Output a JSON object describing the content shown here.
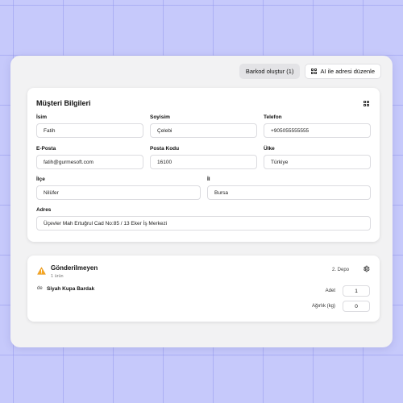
{
  "toolbar": {
    "barcode_label": "Barkod oluştur (1)",
    "ai_address_label": "AI ile adresi düzenle",
    "ai_icon": "grid-icon"
  },
  "customer": {
    "title": "Müşteri Bilgileri",
    "corner_icon": "grid-icon",
    "fields": {
      "first_name": {
        "label": "İsim",
        "value": "Fatih"
      },
      "last_name": {
        "label": "Soyisim",
        "value": "Çelebi"
      },
      "phone": {
        "label": "Telefon",
        "value": "+905055555555"
      },
      "email": {
        "label": "E-Posta",
        "value": "fatih@gurmesoft.com"
      },
      "postal_code": {
        "label": "Posta Kodu",
        "value": "16100"
      },
      "country": {
        "label": "Ülke",
        "value": "Türkiye"
      },
      "district": {
        "label": "İlçe",
        "value": "Nilüfer"
      },
      "city": {
        "label": "İl",
        "value": "Bursa"
      },
      "address": {
        "label": "Adres",
        "value": "Üçevler Mah Ertuğrul Cad No:85 / 13 Eker İş Merkezi"
      }
    }
  },
  "shipment": {
    "status_icon": "warning-icon",
    "status": "Gönderilmeyen",
    "count": "1 ürün",
    "depot": "2. Depo",
    "settings_icon": "gear-icon",
    "item": {
      "tag": "de",
      "name": "Siyah Kupa Bardak",
      "qty_label": "Adet",
      "qty_value": "1",
      "weight_label": "Ağırlık (kg)",
      "weight_value": "0"
    }
  },
  "colors": {
    "background": "#c6c9fb",
    "warning": "#f5a623"
  }
}
